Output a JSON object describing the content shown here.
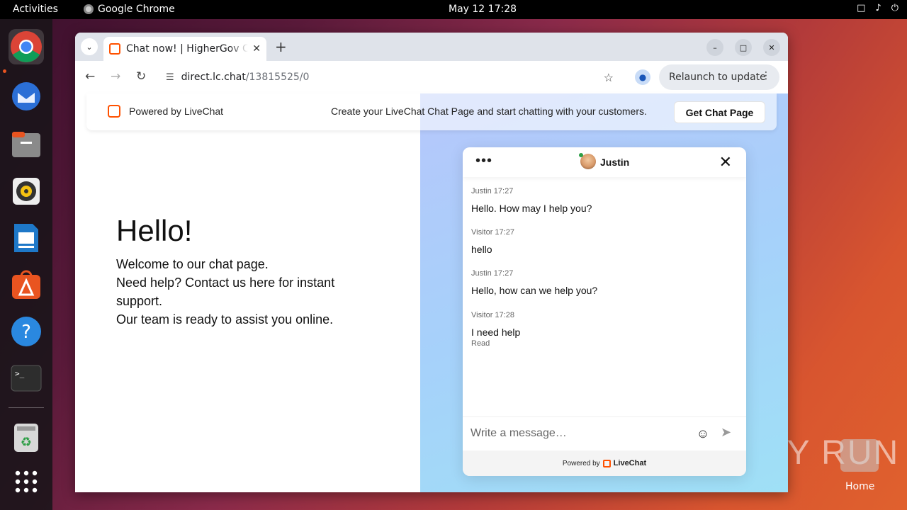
{
  "topbar": {
    "activities": "Activities",
    "app_name": "Google Chrome",
    "clock": "May 12  17:28"
  },
  "dock": {
    "items": [
      "chrome-icon",
      "thunderbird-icon",
      "files-icon",
      "rhythmbox-icon",
      "writer-icon",
      "app-center-icon",
      "help-icon",
      "terminal-icon",
      "trash-icon",
      "apps-grid-icon"
    ]
  },
  "browser": {
    "tab_title": "Chat now! | HigherGov Chat",
    "url_host": "direct.lc.chat",
    "url_path": "/13815525/0",
    "relaunch_label": "Relaunch to update"
  },
  "banner": {
    "powered": "Powered by LiveChat",
    "cta_text": "Create your LiveChat Chat Page and start chatting with your customers.",
    "button": "Get Chat Page"
  },
  "intro": {
    "heading": "Hello!",
    "line1": "Welcome to our chat page.",
    "line2": "Need help? Contact us here for instant support.",
    "line3": "Our team is ready to assist you online."
  },
  "chat": {
    "agent_name": "Justin",
    "messages": [
      {
        "meta": "Justin 17:27",
        "text": "Hello. How may I help you?"
      },
      {
        "meta": "Visitor 17:27",
        "text": "hello"
      },
      {
        "meta": "Justin 17:27",
        "text": "Hello, how can we help you?"
      },
      {
        "meta": "Visitor 17:28",
        "text": "I need help"
      }
    ],
    "read_status": "Read",
    "input_placeholder": "Write a message…",
    "footer_powered": "Powered by",
    "footer_brand": "LiveChat"
  },
  "desktop": {
    "watermark": "ANY RUN",
    "home_label": "Home"
  }
}
